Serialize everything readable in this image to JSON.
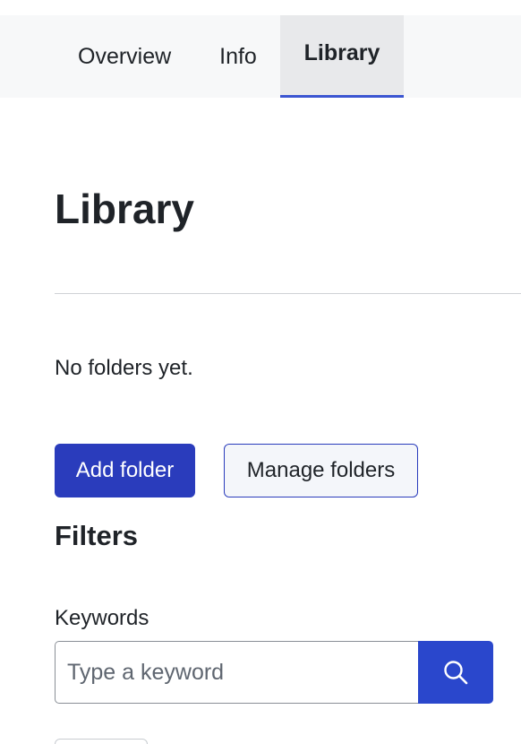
{
  "tabs": [
    {
      "label": "Overview",
      "active": false
    },
    {
      "label": "Info",
      "active": false
    },
    {
      "label": "Library",
      "active": true
    }
  ],
  "page_title": "Library",
  "empty_message": "No folders yet.",
  "actions": {
    "add_folder_label": "Add folder",
    "manage_folders_label": "Manage folders"
  },
  "filters": {
    "title": "Filters",
    "keywords_label": "Keywords",
    "keywords_placeholder": "Type a keyword",
    "keywords_value": "",
    "search_icon": "search-icon"
  },
  "colors": {
    "accent": "#2a3cbc",
    "tab_active_underline": "#3b55d1",
    "tab_bar_bg": "#f7f8f9"
  }
}
